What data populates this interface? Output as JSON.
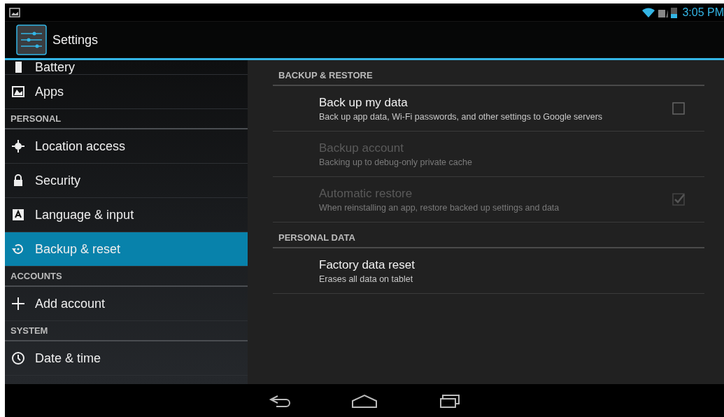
{
  "status_bar": {
    "time": "3:05 PM"
  },
  "action_bar": {
    "title": "Settings"
  },
  "sidebar": {
    "items": [
      {
        "kind": "item",
        "label": "Battery",
        "selected": false
      },
      {
        "kind": "item",
        "label": "Apps",
        "selected": false
      },
      {
        "kind": "header",
        "label": "PERSONAL"
      },
      {
        "kind": "item",
        "label": "Location access",
        "selected": false
      },
      {
        "kind": "item",
        "label": "Security",
        "selected": false
      },
      {
        "kind": "item",
        "label": "Language & input",
        "selected": false
      },
      {
        "kind": "item",
        "label": "Backup & reset",
        "selected": true
      },
      {
        "kind": "header",
        "label": "ACCOUNTS"
      },
      {
        "kind": "item",
        "label": "Add account",
        "selected": false
      },
      {
        "kind": "header",
        "label": "SYSTEM"
      },
      {
        "kind": "item",
        "label": "Date & time",
        "selected": false
      }
    ]
  },
  "sections": [
    {
      "title": "BACKUP & RESTORE",
      "items": [
        {
          "title": "Back up my data",
          "summary": "Back up app data, Wi-Fi passwords, and other settings to Google servers",
          "disabled": false,
          "kind": "checkbox",
          "checked": false
        },
        {
          "title": "Backup account",
          "summary": "Backing up to debug-only private cache",
          "disabled": true,
          "kind": "plain"
        },
        {
          "title": "Automatic restore",
          "summary": "When reinstalling an app, restore backed up settings and data",
          "disabled": true,
          "kind": "checkbox",
          "checked": true
        }
      ]
    },
    {
      "title": "PERSONAL DATA",
      "items": [
        {
          "title": "Factory data reset",
          "summary": "Erases all data on tablet",
          "disabled": false,
          "kind": "plain"
        }
      ]
    }
  ]
}
